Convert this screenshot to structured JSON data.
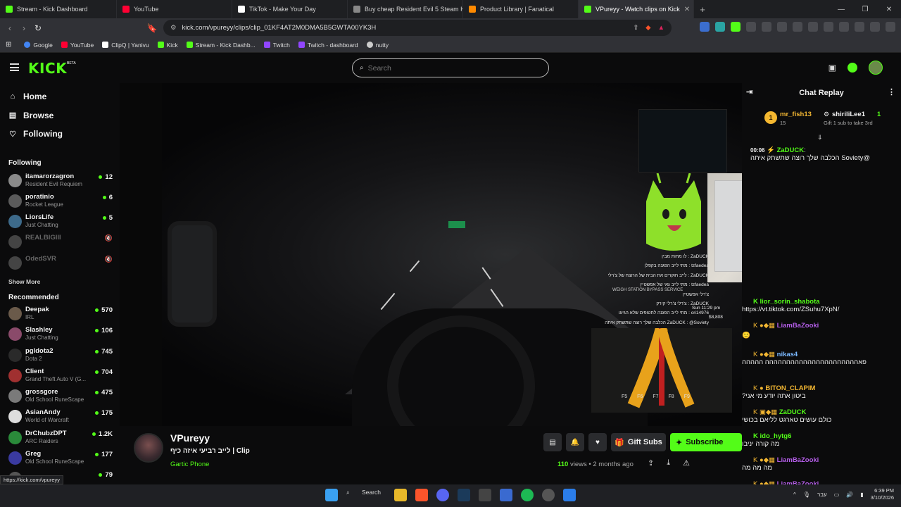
{
  "browser": {
    "tabs": [
      {
        "label": "Stream - Kick Dashboard",
        "color": "#53fc18"
      },
      {
        "label": "YouTube",
        "color": "#ff0033"
      },
      {
        "label": "TikTok - Make Your Day",
        "color": "#ffffff"
      },
      {
        "label": "Buy cheap Resident Evil 5 Steam Key",
        "color": "#888888"
      },
      {
        "label": "Product Library | Fanatical",
        "color": "#ff8a00"
      },
      {
        "label": "VPureyy - Watch clips on Kick",
        "color": "#53fc18"
      }
    ],
    "url": "kick.com/vpureyy/clips/clip_01KF4AT2M0DMA5B5GWTA00YK3H",
    "bookmarks": [
      {
        "label": "Google",
        "color": "#4285f4"
      },
      {
        "label": "YouTube",
        "color": "#ff0033"
      },
      {
        "label": "ClipQ | Yanivu",
        "color": "#ffffff"
      },
      {
        "label": "Kick",
        "color": "#53fc18"
      },
      {
        "label": "Stream - Kick Dashb...",
        "color": "#53fc18"
      },
      {
        "label": "Twitch",
        "color": "#9146ff"
      },
      {
        "label": "Twitch - dashboard",
        "color": "#9146ff"
      },
      {
        "label": "nutty",
        "color": "#cccccc"
      }
    ],
    "status_url": "https://kick.com/vpureyy"
  },
  "header": {
    "logo": "KICK",
    "beta": "BETA",
    "search_placeholder": "Search"
  },
  "sidebar": {
    "nav": [
      {
        "label": "Home",
        "icon": "home-icon"
      },
      {
        "label": "Browse",
        "icon": "browse-icon"
      },
      {
        "label": "Following",
        "icon": "heart-icon"
      }
    ],
    "following_title": "Following",
    "following": [
      {
        "name": "itamarorzagron",
        "game": "Resident Evil Requiem",
        "viewers": "12",
        "color": "#8a8a8a",
        "live": true
      },
      {
        "name": "poratinio",
        "game": "Rocket League",
        "viewers": "6",
        "color": "#5b5b5b",
        "live": true
      },
      {
        "name": "LiorsLife",
        "game": "Just Chatting",
        "viewers": "5",
        "color": "#3d6a8a",
        "live": true
      },
      {
        "name": "REALBIGIII",
        "game": "",
        "viewers": "",
        "color": "#444444",
        "live": false
      },
      {
        "name": "OdedSVR",
        "game": "",
        "viewers": "",
        "color": "#444444",
        "live": false
      }
    ],
    "show_more": "Show More",
    "recommended_title": "Recommended",
    "recommended": [
      {
        "name": "Deepak",
        "game": "IRL",
        "viewers": "570",
        "color": "#6a5a4a"
      },
      {
        "name": "Slashley",
        "game": "Just Chatting",
        "viewers": "106",
        "color": "#8a4a6a"
      },
      {
        "name": "pgldota2",
        "game": "Dota 2",
        "viewers": "745",
        "color": "#2a2a2a"
      },
      {
        "name": "Client",
        "game": "Grand Theft Auto V (G...",
        "viewers": "704",
        "color": "#a03030"
      },
      {
        "name": "grossgore",
        "game": "Old School RuneScape",
        "viewers": "475",
        "color": "#7a7a7a"
      },
      {
        "name": "AsianAndy",
        "game": "World of Warcraft",
        "viewers": "175",
        "color": "#dddddd"
      },
      {
        "name": "DrChubzDPT",
        "game": "ARC Raiders",
        "viewers": "1.2K",
        "color": "#2a8a3a"
      },
      {
        "name": "Greg",
        "game": "Old School RuneScape",
        "viewers": "177",
        "color": "#3a3aa0"
      },
      {
        "name": "",
        "game": "",
        "viewers": "79",
        "color": "#555555"
      }
    ]
  },
  "video": {
    "overlay_chat": [
      "ZaDUCK : לו מחות מבין",
      "tzfaedea : מתי לייב הפגנה בקפלן",
      "ZaDUCK : לייב חוקרים את הבית של הרוצח של צ'רלי",
      "tzfaedea : מתי לייב גאי של אפשטיין",
      "צ'רלי אפשטיין",
      "ZaDUCK : צ'רלי צ'רלי קירק",
      "ori14976 : מתי לייב הפגנה לחטופים שלא הגיעו",
      "ZaDUCK : @Soviety הכלבה שלך רוצה שתשתק איתה"
    ],
    "fkeys": [
      "F5",
      "F6",
      "F7",
      "F8",
      "F9"
    ],
    "road_sign": "WEIGH STATION BYPASS SERVICE",
    "overlay_time": "Sun 11:29 pm",
    "overlay_money": "$8,808"
  },
  "channel": {
    "name": "VPureyy",
    "title": "לייב רביעי איזה כיף | Clip",
    "category": "Gartic Phone",
    "gift_label": "Gift Subs",
    "subscribe_label": "Subscribe",
    "views_count": "110",
    "views_label": "views",
    "age": "• 2 months ago"
  },
  "chat": {
    "title": "Chat Replay",
    "pinned": [
      {
        "name": "mr_fish13",
        "sub": "15",
        "rank": "1"
      },
      {
        "name": "shiriliLee1",
        "sub": "Gift 1 sub to take 3rd",
        "rank": "1"
      }
    ],
    "messages": [
      {
        "ts": "00:06",
        "user": "ZaDUCK",
        "color": "#53fc18",
        "text": "@Soviety הכלבה שלך רוצה שתשתק איתה"
      },
      {
        "ts": "",
        "user": "lior_sorin_shabota",
        "color": "#53fc18",
        "text": "https://vt.tiktok.com/ZSuhu7XpN/"
      },
      {
        "ts": "",
        "user": "LiamBaZooki",
        "color": "#b45ee8",
        "text": "🙂"
      },
      {
        "ts": "",
        "user": "nikas4",
        "color": "#7ab8ff",
        "text": "פאהההההההההההההההההההההה ההההה"
      },
      {
        "ts": "",
        "user": "BITON_CLAPIM",
        "color": "#f2b632",
        "text": "ביטון אתה יודע מי אני?"
      },
      {
        "ts": "",
        "user": "ZaDUCK",
        "color": "#53fc18",
        "text": "כולם עושים טארגט לליאם בכושי"
      },
      {
        "ts": "",
        "user": "ido_hytg6",
        "color": "#53fc18",
        "text": "מה קורה יניבו"
      },
      {
        "ts": "",
        "user": "LiamBaZooki",
        "color": "#b45ee8",
        "text": "מה מה מה"
      },
      {
        "ts": "",
        "user": "LiamBaZooki",
        "color": "#b45ee8",
        "text": "מה ביטון אמר?"
      }
    ]
  },
  "taskbar": {
    "search_label": "Search",
    "lang": "עבר",
    "time": "6:39 PM",
    "date": "3/10/2026"
  },
  "colors": {
    "accent": "#53fc18",
    "bg": "#0b0b0c"
  }
}
